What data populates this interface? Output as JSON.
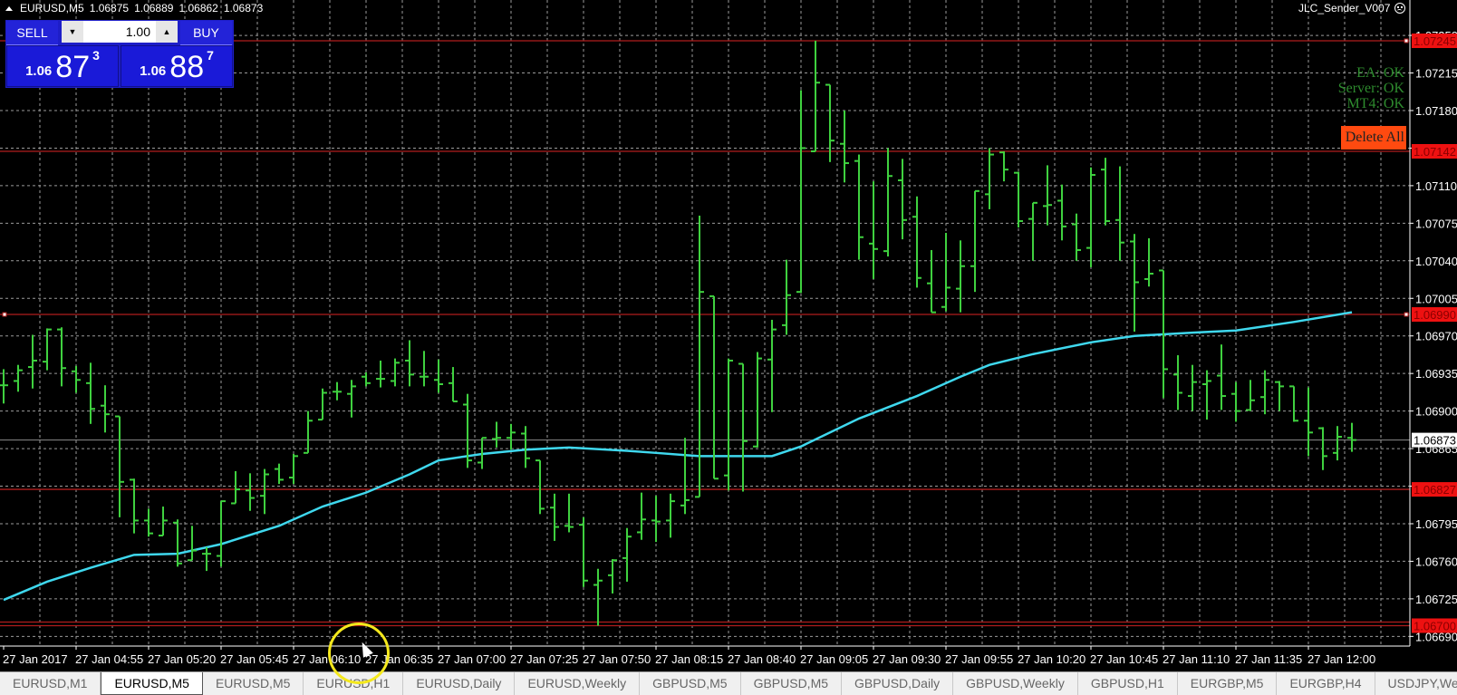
{
  "header": {
    "symbol": "EURUSD,M5",
    "ohlc": [
      "1.06875",
      "1.06889",
      "1.06862",
      "1.06873"
    ]
  },
  "expert": {
    "name": "JLC_Sender_V007",
    "icon": "sad-face-icon"
  },
  "trade_panel": {
    "sell_label": "SELL",
    "buy_label": "BUY",
    "lots": "1.00",
    "sell_price": {
      "prefix": "1.06",
      "big": "87",
      "small": "3"
    },
    "buy_price": {
      "prefix": "1.06",
      "big": "88",
      "small": "7"
    }
  },
  "status": {
    "ea": "EA: OK",
    "server": "Server: OK",
    "mt4": "MT4: OK",
    "delete_all": "Delete All"
  },
  "tabs": [
    "EURUSD,M1",
    "EURUSD,M5",
    "EURUSD,M5",
    "EURUSD,H1",
    "EURUSD,Daily",
    "EURUSD,Weekly",
    "GBPUSD,M5",
    "GBPUSD,M5",
    "GBPUSD,Daily",
    "GBPUSD,Weekly",
    "GBPUSD,H1",
    "EURGBP,M5",
    "EURGBP,H4",
    "USDJPY,Wee"
  ],
  "active_tab": 1,
  "chart_data": {
    "type": "ohlc",
    "symbol": "EURUSD",
    "timeframe": "M5",
    "ylim": [
      1.06681,
      1.07283
    ],
    "grid": true,
    "colors": {
      "bars": "#3fd13f",
      "ma": "#3fd8ee",
      "level": "#b01c1c",
      "level_label_bg": "#ee1111",
      "level_label_text": "#8a0000",
      "current": "#8c8c8c",
      "grid": "#9a9a9a",
      "axis": "#ffffff"
    },
    "price_ticks": [
      "1.07250",
      "1.07215",
      "1.07180",
      "1.07145",
      "1.07110",
      "1.07075",
      "1.07040",
      "1.07005",
      "1.06970",
      "1.06935",
      "1.06900",
      "1.06865",
      "1.06830",
      "1.06795",
      "1.06760",
      "1.06725",
      "1.06690"
    ],
    "time_labels": [
      "27 Jan 2017",
      "27 Jan 04:55",
      "27 Jan 05:20",
      "27 Jan 05:45",
      "27 Jan 06:10",
      "27 Jan 06:35",
      "27 Jan 07:00",
      "27 Jan 07:25",
      "27 Jan 07:50",
      "27 Jan 08:15",
      "27 Jan 08:40",
      "27 Jan 09:05",
      "27 Jan 09:30",
      "27 Jan 09:55",
      "27 Jan 10:20",
      "27 Jan 10:45",
      "27 Jan 11:10",
      "27 Jan 11:35",
      "27 Jan 12:00"
    ],
    "bars_per_label": 5,
    "levels": [
      {
        "price": 1.07245,
        "label": "1.07245"
      },
      {
        "price": 1.07142,
        "label": "1.07142"
      },
      {
        "price": 1.0699,
        "label": "1.06990"
      },
      {
        "price": 1.06827,
        "label": "1.06827"
      },
      {
        "price": 1.067,
        "label": "1.06700",
        "double": true
      }
    ],
    "current_price": {
      "price": 1.06873,
      "label": "1.06873"
    },
    "ohlc": [
      [
        1.06924,
        1.06939,
        1.06907,
        1.06924
      ],
      [
        1.06928,
        1.06943,
        1.06918,
        1.06938
      ],
      [
        1.06941,
        1.06971,
        1.06921,
        1.06947
      ],
      [
        1.06946,
        1.06977,
        1.06938,
        1.06976
      ],
      [
        1.06976,
        1.06978,
        1.06923,
        1.0694
      ],
      [
        1.06937,
        1.06942,
        1.06917,
        1.06929
      ],
      [
        1.06926,
        1.06945,
        1.06888,
        1.06902
      ],
      [
        1.06905,
        1.06924,
        1.0688,
        1.06897
      ],
      [
        1.06895,
        1.06895,
        1.06801,
        1.06834
      ],
      [
        1.06836,
        1.06837,
        1.06786,
        1.06798
      ],
      [
        1.06798,
        1.06809,
        1.06783,
        1.06786
      ],
      [
        1.06784,
        1.06811,
        1.06784,
        1.06798
      ],
      [
        1.06796,
        1.06799,
        1.06755,
        1.06758
      ],
      [
        1.06761,
        1.06793,
        1.06761,
        1.0677
      ],
      [
        1.06767,
        1.06773,
        1.06751,
        1.06767
      ],
      [
        1.06765,
        1.06816,
        1.06755,
        1.06816
      ],
      [
        1.06814,
        1.06844,
        1.06814,
        1.06827
      ],
      [
        1.06826,
        1.06842,
        1.06807,
        1.06819
      ],
      [
        1.06821,
        1.06846,
        1.06804,
        1.06841
      ],
      [
        1.06846,
        1.06851,
        1.06832,
        1.06836
      ],
      [
        1.06838,
        1.0686,
        1.06832,
        1.06858
      ],
      [
        1.06861,
        1.069,
        1.06861,
        1.06891
      ],
      [
        1.06892,
        1.06921,
        1.06892,
        1.06917
      ],
      [
        1.06918,
        1.06927,
        1.0691,
        1.06918
      ],
      [
        1.06916,
        1.06929,
        1.06894,
        1.06923
      ],
      [
        1.06932,
        1.06936,
        1.06923,
        1.06926
      ],
      [
        1.0693,
        1.06947,
        1.06922,
        1.0693
      ],
      [
        1.06928,
        1.06949,
        1.06923,
        1.06945
      ],
      [
        1.06947,
        1.06966,
        1.06923,
        1.06934
      ],
      [
        1.06932,
        1.06956,
        1.06923,
        1.06932
      ],
      [
        1.06929,
        1.06948,
        1.06917,
        1.06925
      ],
      [
        1.06926,
        1.06941,
        1.06909,
        1.06909
      ],
      [
        1.06906,
        1.06916,
        1.06847,
        1.06854
      ],
      [
        1.06852,
        1.06875,
        1.06846,
        1.06875
      ],
      [
        1.06874,
        1.0689,
        1.06866,
        1.06875
      ],
      [
        1.06875,
        1.06888,
        1.06864,
        1.0688
      ],
      [
        1.06879,
        1.06886,
        1.06847,
        1.06856
      ],
      [
        1.06854,
        1.06854,
        1.06804,
        1.06809
      ],
      [
        1.0681,
        1.06823,
        1.06779,
        1.06792
      ],
      [
        1.06793,
        1.06823,
        1.06787,
        1.06792
      ],
      [
        1.06794,
        1.06801,
        1.06736,
        1.06742
      ],
      [
        1.06738,
        1.06753,
        1.067,
        1.06742
      ],
      [
        1.06747,
        1.06762,
        1.0673,
        1.06761
      ],
      [
        1.06763,
        1.06791,
        1.06741,
        1.06783
      ],
      [
        1.06787,
        1.06824,
        1.0678,
        1.06799
      ],
      [
        1.06798,
        1.06821,
        1.06778,
        1.06797
      ],
      [
        1.06798,
        1.06823,
        1.06782,
        1.06816
      ],
      [
        1.06812,
        1.06875,
        1.06804,
        1.06817
      ],
      [
        1.0682,
        1.07082,
        1.0682,
        1.07011
      ],
      [
        1.07007,
        1.07007,
        1.06837,
        1.06837
      ],
      [
        1.0684,
        1.06949,
        1.06826,
        1.06947
      ],
      [
        1.06944,
        1.06944,
        1.06825,
        1.06872
      ],
      [
        1.06867,
        1.06955,
        1.06866,
        1.06949
      ],
      [
        1.06948,
        1.06985,
        1.06899,
        1.06976
      ],
      [
        1.0698,
        1.07041,
        1.06971,
        1.07008
      ],
      [
        1.07011,
        1.07199,
        1.0701,
        1.07145
      ],
      [
        1.07142,
        1.07245,
        1.07142,
        1.07206
      ],
      [
        1.07204,
        1.07204,
        1.07132,
        1.07152
      ],
      [
        1.07149,
        1.0718,
        1.07113,
        1.07131
      ],
      [
        1.07133,
        1.07139,
        1.07041,
        1.07062
      ],
      [
        1.07056,
        1.07114,
        1.07023,
        1.07051
      ],
      [
        1.07049,
        1.07145,
        1.07044,
        1.07119
      ],
      [
        1.07115,
        1.07135,
        1.0706,
        1.07078
      ],
      [
        1.07081,
        1.071,
        1.07015,
        1.07024
      ],
      [
        1.07019,
        1.0705,
        1.06992,
        1.06992
      ],
      [
        1.06997,
        1.07066,
        1.06993,
        1.07015
      ],
      [
        1.07014,
        1.07059,
        1.06992,
        1.07035
      ],
      [
        1.07035,
        1.07105,
        1.07011,
        1.07105
      ],
      [
        1.07102,
        1.07145,
        1.07088,
        1.07139
      ],
      [
        1.07141,
        1.07142,
        1.07114,
        1.07125
      ],
      [
        1.07122,
        1.07123,
        1.07071,
        1.07077
      ],
      [
        1.07079,
        1.07094,
        1.0704,
        1.07094
      ],
      [
        1.07091,
        1.07129,
        1.07073,
        1.07092
      ],
      [
        1.07096,
        1.07111,
        1.07059,
        1.07072
      ],
      [
        1.07074,
        1.07084,
        1.0704,
        1.0705
      ],
      [
        1.07052,
        1.07127,
        1.07034,
        1.0712
      ],
      [
        1.07125,
        1.07136,
        1.07073,
        1.07077
      ],
      [
        1.07078,
        1.07128,
        1.0704,
        1.07057
      ],
      [
        1.07058,
        1.07065,
        1.06974,
        1.0702
      ],
      [
        1.07023,
        1.07061,
        1.07016,
        1.07028
      ],
      [
        1.07031,
        1.07031,
        1.06912,
        1.06939
      ],
      [
        1.06934,
        1.06952,
        1.06901,
        1.06917
      ],
      [
        1.06914,
        1.06943,
        1.069,
        1.06927
      ],
      [
        1.06925,
        1.06938,
        1.06892,
        1.06928
      ],
      [
        1.06933,
        1.06962,
        1.06901,
        1.06914
      ],
      [
        1.06916,
        1.06927,
        1.0689,
        1.069
      ],
      [
        1.06901,
        1.06929,
        1.069,
        1.0691
      ],
      [
        1.06913,
        1.06938,
        1.06897,
        1.06929
      ],
      [
        1.06927,
        1.06928,
        1.069,
        1.06923
      ],
      [
        1.06923,
        1.06923,
        1.0689,
        1.06891
      ],
      [
        1.06891,
        1.06922,
        1.06858,
        1.0688
      ],
      [
        1.06884,
        1.06885,
        1.06845,
        1.06858
      ],
      [
        1.06861,
        1.06886,
        1.06854,
        1.06876
      ],
      [
        1.06875,
        1.06889,
        1.06862,
        1.06873
      ]
    ],
    "moving_average": [
      [
        0,
        1.06724
      ],
      [
        3,
        1.06741
      ],
      [
        6,
        1.06754
      ],
      [
        9,
        1.06766
      ],
      [
        12,
        1.06767
      ],
      [
        15,
        1.06776
      ],
      [
        19,
        1.06793
      ],
      [
        22,
        1.06811
      ],
      [
        25,
        1.06824
      ],
      [
        28,
        1.06841
      ],
      [
        30,
        1.06854
      ],
      [
        33,
        1.0686
      ],
      [
        36,
        1.06864
      ],
      [
        39,
        1.06866
      ],
      [
        43,
        1.06863
      ],
      [
        45,
        1.06861
      ],
      [
        48,
        1.06858
      ],
      [
        53,
        1.06858
      ],
      [
        55,
        1.06867
      ],
      [
        59,
        1.06893
      ],
      [
        63,
        1.06914
      ],
      [
        66,
        1.06932
      ],
      [
        68,
        1.06943
      ],
      [
        71,
        1.06953
      ],
      [
        75,
        1.06964
      ],
      [
        78,
        1.0697
      ],
      [
        82,
        1.06973
      ],
      [
        85,
        1.06975
      ],
      [
        89,
        1.06983
      ],
      [
        93,
        1.06992
      ]
    ]
  }
}
